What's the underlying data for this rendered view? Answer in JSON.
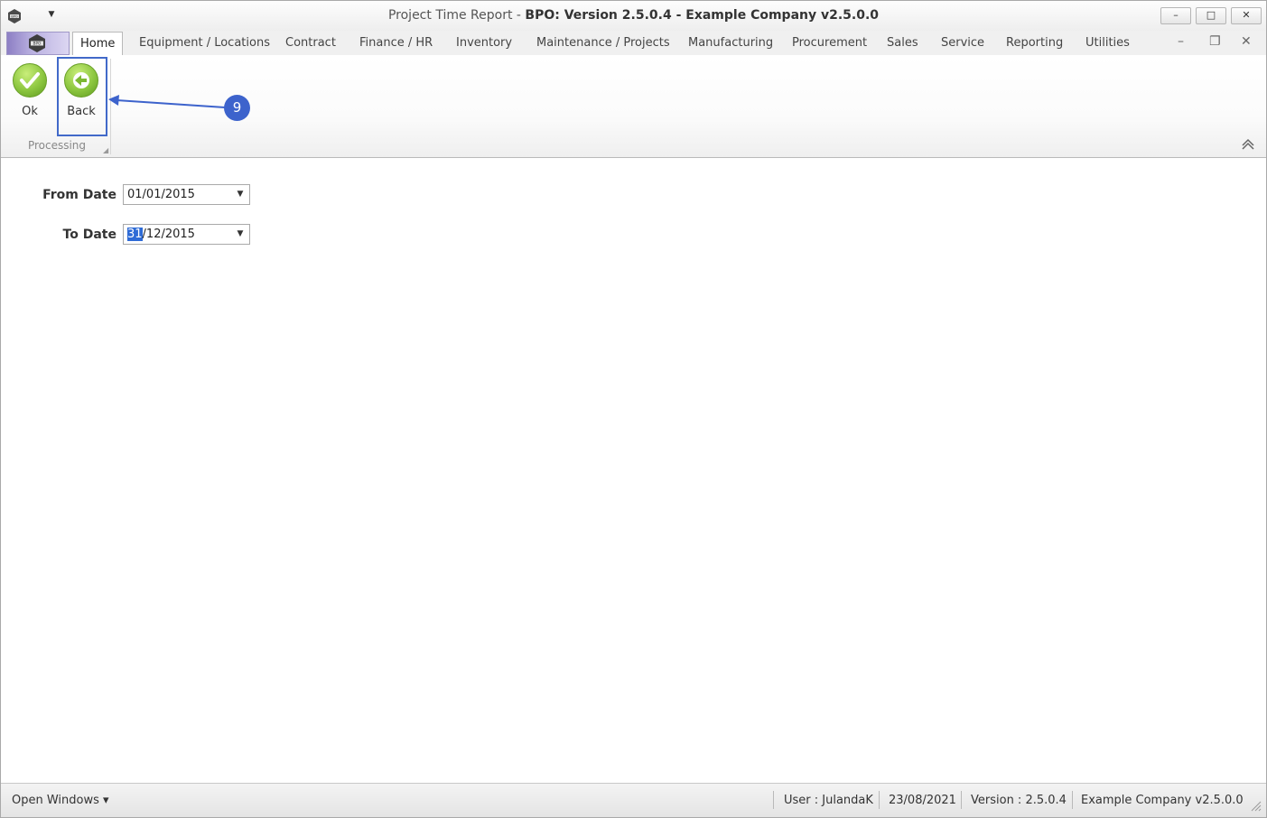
{
  "titlebar": {
    "title_prefix": "Project Time Report - ",
    "title_main": "BPO: Version 2.5.0.4 - Example Company v2.5.0.0",
    "minimize": "–",
    "maximize": "□",
    "close": "✕",
    "qat_dropdown": "▼"
  },
  "ribbon_tabs": [
    {
      "label": "Home"
    },
    {
      "label": "Equipment / Locations"
    },
    {
      "label": "Contract"
    },
    {
      "label": "Finance / HR"
    },
    {
      "label": "Inventory"
    },
    {
      "label": "Maintenance / Projects"
    },
    {
      "label": "Manufacturing"
    },
    {
      "label": "Procurement"
    },
    {
      "label": "Sales"
    },
    {
      "label": "Service"
    },
    {
      "label": "Reporting"
    },
    {
      "label": "Utilities"
    }
  ],
  "mdi_controls": {
    "minimize": "–",
    "restore": "❐",
    "close": "✕"
  },
  "ribbon": {
    "ok_label": "Ok",
    "back_label": "Back",
    "group_label": "Processing",
    "group_corner": "◢"
  },
  "callout": {
    "number": "9",
    "color": "#3d63cc"
  },
  "form": {
    "from_date_label": "From Date",
    "from_date_value": "01/01/2015",
    "to_date_label": "To Date",
    "to_date_selected": "31",
    "to_date_rest": "/12/2015",
    "dropdown_arrow": "▼"
  },
  "statusbar": {
    "open_windows": "Open Windows ▾",
    "user": "User : JulandaK",
    "date": "23/08/2021",
    "version": "Version : 2.5.0.4",
    "company": "Example Company v2.5.0.0"
  },
  "colors": {
    "accent": "#3d63cc",
    "button_green": "#8cc63f",
    "selection": "#2e6bd6"
  }
}
